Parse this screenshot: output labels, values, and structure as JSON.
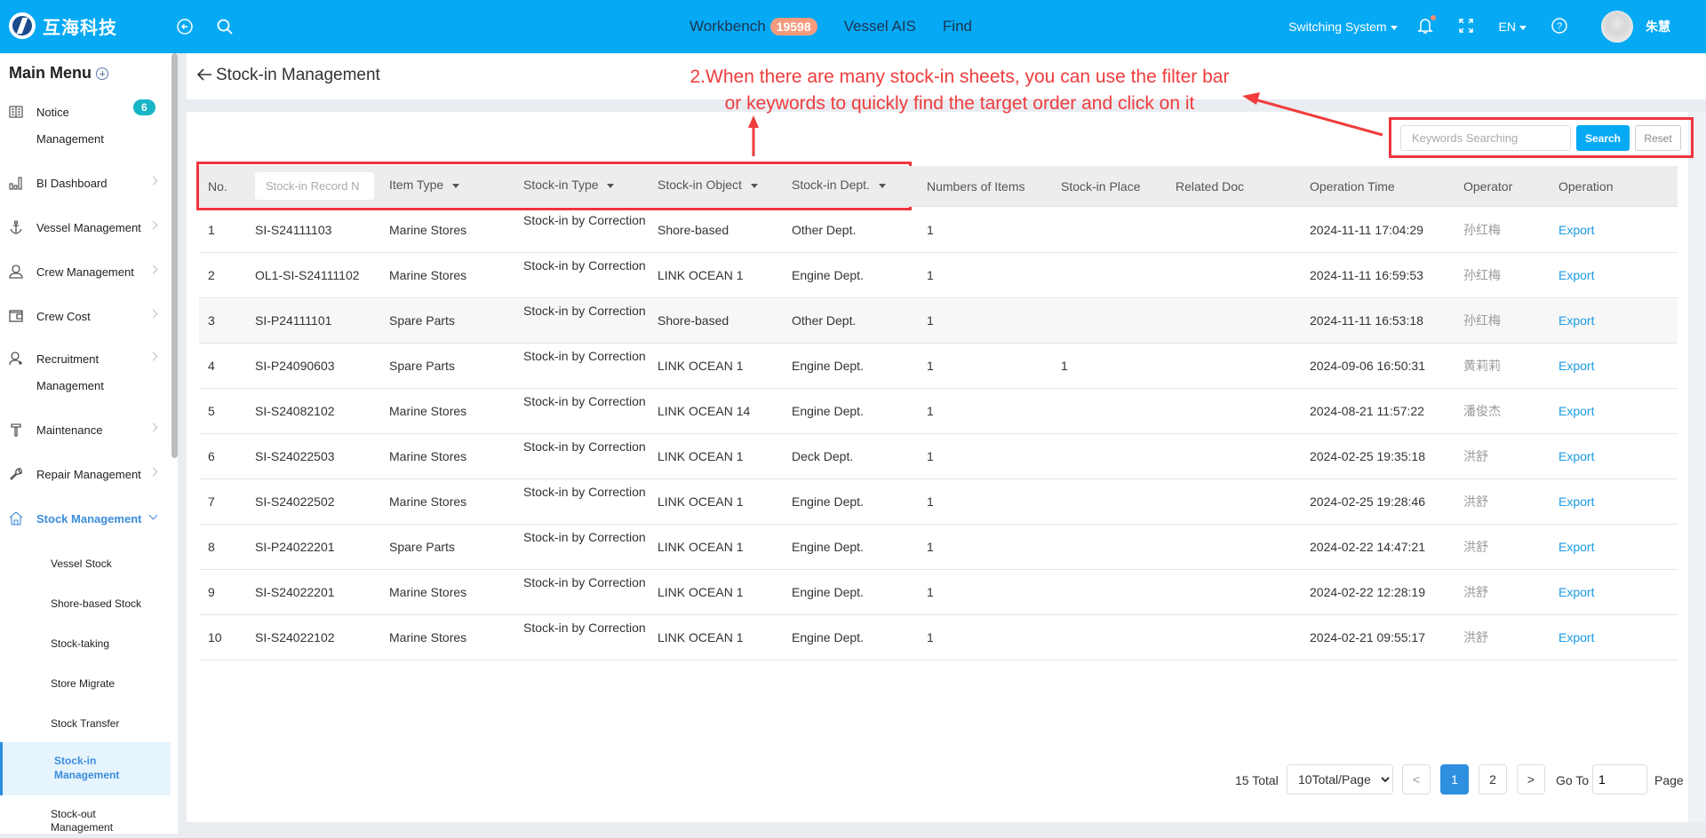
{
  "topbar": {
    "brand": "互海科技",
    "nav": [
      {
        "label": "Workbench",
        "badge": "19598"
      },
      {
        "label": "Vessel AIS"
      },
      {
        "label": "Find"
      }
    ],
    "switching_system": "Switching System",
    "language": "EN",
    "user_name": "朱慧",
    "colors": {
      "bar": "#05a9f4",
      "badge": "#f79a7e"
    }
  },
  "sidebar": {
    "title": "Main Menu",
    "items": [
      {
        "label_line1": "Notice",
        "label_line2": "Management",
        "icon": "book-icon",
        "badge": "6"
      },
      {
        "label": "BI Dashboard",
        "icon": "bar-chart-icon"
      },
      {
        "label": "Vessel Management",
        "icon": "anchor-icon"
      },
      {
        "label": "Crew Management",
        "icon": "user-icon"
      },
      {
        "label": "Crew Cost",
        "icon": "wallet-icon"
      },
      {
        "label_line1": "Recruitment",
        "label_line2": "Management",
        "icon": "user-add-icon"
      },
      {
        "label": "Maintenance",
        "icon": "hammer-icon"
      },
      {
        "label": "Repair Management",
        "icon": "wrench-icon"
      },
      {
        "label": "Stock Management",
        "icon": "home-icon",
        "expanded": true
      }
    ],
    "submenu": [
      {
        "label": "Vessel Stock"
      },
      {
        "label": "Shore-based Stock"
      },
      {
        "label": "Stock-taking"
      },
      {
        "label": "Store Migrate"
      },
      {
        "label": "Stock Transfer"
      },
      {
        "label_line1": "Stock-in",
        "label_line2": "Management",
        "active": true
      },
      {
        "label_line1": "Stock-out",
        "label_line2": "Management"
      }
    ]
  },
  "page": {
    "title": "Stock-in Management"
  },
  "annotation": {
    "line1": "2.When there are many stock-in sheets, you can use the filter bar",
    "line2": "or keywords to quickly find the target order and click on it",
    "color": "#f03c3c"
  },
  "search": {
    "placeholder": "Keywords Searching",
    "value": "",
    "search_label": "Search",
    "reset_label": "Reset"
  },
  "table": {
    "columns": {
      "no": "No.",
      "record_placeholder": "Stock-in Record N",
      "item_type": "Item Type",
      "stockin_type": "Stock-in Type",
      "stockin_object": "Stock-in Object",
      "stockin_dept": "Stock-in Dept.",
      "num_items": "Numbers of Items",
      "stockin_place": "Stock-in Place",
      "related_doc": "Related Doc",
      "operation_time": "Operation Time",
      "operator": "Operator",
      "operation": "Operation"
    },
    "rows": [
      {
        "no": "1",
        "record": "SI-S24111103",
        "item_type": "Marine Stores",
        "stockin_type": "Stock-in by Correction",
        "object": "Shore-based",
        "dept": "Other Dept.",
        "num": "1",
        "place": "",
        "doc": "",
        "time": "2024-11-11 17:04:29",
        "operator": "孙红梅",
        "action": "Export"
      },
      {
        "no": "2",
        "record": "OL1-SI-S24111102",
        "item_type": "Marine Stores",
        "stockin_type": "Stock-in by Correction",
        "object": "LINK OCEAN 1",
        "dept": "Engine Dept.",
        "num": "1",
        "place": "",
        "doc": "",
        "time": "2024-11-11 16:59:53",
        "operator": "孙红梅",
        "action": "Export"
      },
      {
        "no": "3",
        "record": "SI-P24111101",
        "item_type": "Spare Parts",
        "stockin_type": "Stock-in by Correction",
        "object": "Shore-based",
        "dept": "Other Dept.",
        "num": "1",
        "place": "",
        "doc": "",
        "time": "2024-11-11 16:53:18",
        "operator": "孙红梅",
        "action": "Export"
      },
      {
        "no": "4",
        "record": "SI-P24090603",
        "item_type": "Spare Parts",
        "stockin_type": "Stock-in by Correction",
        "object": "LINK OCEAN 1",
        "dept": "Engine Dept.",
        "num": "1",
        "place": "1",
        "doc": "",
        "time": "2024-09-06 16:50:31",
        "operator": "黄莉莉",
        "action": "Export"
      },
      {
        "no": "5",
        "record": "SI-S24082102",
        "item_type": "Marine Stores",
        "stockin_type": "Stock-in by Correction",
        "object": "LINK OCEAN 14",
        "dept": "Engine Dept.",
        "num": "1",
        "place": "",
        "doc": "",
        "time": "2024-08-21 11:57:22",
        "operator": "潘俊杰",
        "action": "Export"
      },
      {
        "no": "6",
        "record": "SI-S24022503",
        "item_type": "Marine Stores",
        "stockin_type": "Stock-in by Correction",
        "object": "LINK OCEAN 1",
        "dept": "Deck Dept.",
        "num": "1",
        "place": "",
        "doc": "",
        "time": "2024-02-25 19:35:18",
        "operator": "洪舒",
        "action": "Export"
      },
      {
        "no": "7",
        "record": "SI-S24022502",
        "item_type": "Marine Stores",
        "stockin_type": "Stock-in by Correction",
        "object": "LINK OCEAN 1",
        "dept": "Engine Dept.",
        "num": "1",
        "place": "",
        "doc": "",
        "time": "2024-02-25 19:28:46",
        "operator": "洪舒",
        "action": "Export"
      },
      {
        "no": "8",
        "record": "SI-P24022201",
        "item_type": "Spare Parts",
        "stockin_type": "Stock-in by Correction",
        "object": "LINK OCEAN 1",
        "dept": "Engine Dept.",
        "num": "1",
        "place": "",
        "doc": "",
        "time": "2024-02-22 14:47:21",
        "operator": "洪舒",
        "action": "Export"
      },
      {
        "no": "9",
        "record": "SI-S24022201",
        "item_type": "Marine Stores",
        "stockin_type": "Stock-in by Correction",
        "object": "LINK OCEAN 1",
        "dept": "Engine Dept.",
        "num": "1",
        "place": "",
        "doc": "",
        "time": "2024-02-22 12:28:19",
        "operator": "洪舒",
        "action": "Export"
      },
      {
        "no": "10",
        "record": "SI-S24022102",
        "item_type": "Marine Stores",
        "stockin_type": "Stock-in by Correction",
        "object": "LINK OCEAN 1",
        "dept": "Engine Dept.",
        "num": "1",
        "place": "",
        "doc": "",
        "time": "2024-02-21 09:55:17",
        "operator": "洪舒",
        "action": "Export"
      }
    ]
  },
  "pagination": {
    "total_label": "15 Total",
    "page_size": "10Total/Page",
    "prev": "<",
    "pages": [
      "1",
      "2"
    ],
    "current_page": "1",
    "next": ">",
    "goto_label": "Go To",
    "goto_value": "1",
    "page_label": "Page"
  }
}
